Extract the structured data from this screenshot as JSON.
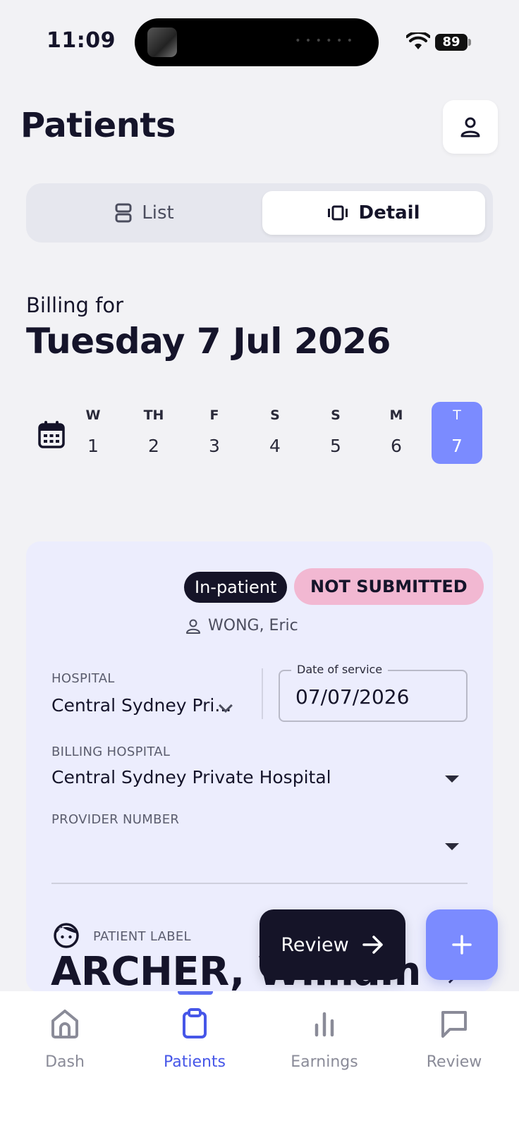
{
  "status_bar": {
    "time": "11:09",
    "battery": "89"
  },
  "header": {
    "title": "Patients"
  },
  "view_toggle": {
    "list_label": "List",
    "detail_label": "Detail",
    "selected": "Detail"
  },
  "billing": {
    "prefix": "Billing for",
    "date": "Tuesday 7 Jul 2026"
  },
  "week": {
    "days": [
      {
        "letter": "W",
        "num": "1"
      },
      {
        "letter": "TH",
        "num": "2"
      },
      {
        "letter": "F",
        "num": "3"
      },
      {
        "letter": "S",
        "num": "4"
      },
      {
        "letter": "S",
        "num": "5"
      },
      {
        "letter": "M",
        "num": "6"
      },
      {
        "letter": "T",
        "num": "7"
      }
    ],
    "selected": "7"
  },
  "card": {
    "type_badge": "In-patient",
    "status_badge": "NOT SUBMITTED",
    "owner": "WONG, Eric",
    "hospital_label": "HOSPITAL",
    "hospital_value": "Central Sydney Pri...",
    "date_label": "Date of service",
    "date_value": "07/07/2026",
    "billing_hospital_label": "BILLING HOSPITAL",
    "billing_hospital_value": "Central Sydney Private Hospital",
    "provider_label": "PROVIDER NUMBER",
    "provider_value": "",
    "patient_label": "PATIENT LABEL",
    "patient_name": "ARCHER, William"
  },
  "fab": {
    "review_label": "Review"
  },
  "tabs": [
    {
      "label": "Dash",
      "icon": "home-icon"
    },
    {
      "label": "Patients",
      "icon": "clipboard-icon"
    },
    {
      "label": "Earnings",
      "icon": "bar-chart-icon"
    },
    {
      "label": "Review",
      "icon": "chat-icon"
    }
  ],
  "colors": {
    "accent": "#7b8bff",
    "active_tab": "#4656e8",
    "dark": "#151428",
    "status_pink": "#f2b8d2",
    "card_bg": "#ecedfd"
  }
}
